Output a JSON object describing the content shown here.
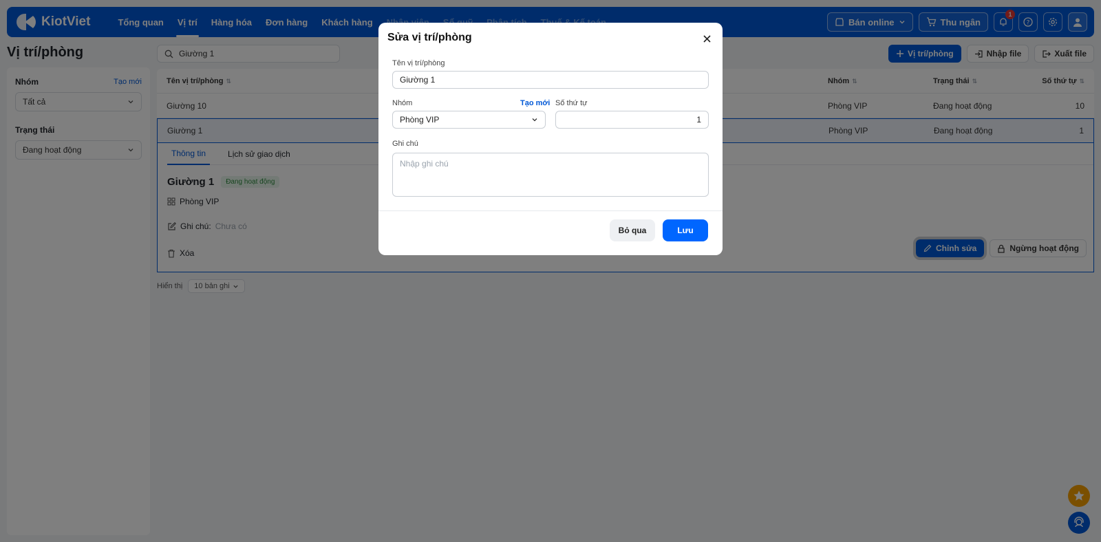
{
  "app": {
    "brand": "KiotViet"
  },
  "nav": {
    "items": [
      "Tổng quan",
      "Vị trí",
      "Hàng hóa",
      "Đơn hàng",
      "Khách hàng",
      "Nhân viên",
      "Sổ quỹ",
      "Phân tích",
      "Thuế & Kế toán"
    ],
    "active": "Vị trí"
  },
  "topbar": {
    "sell_online": "Bán online",
    "cashier": "Thu ngân",
    "notification_count": "1"
  },
  "page": {
    "title": "Vị trí/phòng"
  },
  "sidebar": {
    "group_label": "Nhóm",
    "group_create": "Tạo mới",
    "group_value": "Tất cả",
    "status_label": "Trạng thái",
    "status_value": "Đang hoạt động"
  },
  "toolbar": {
    "search_value": "Giường 1",
    "add_button": "Vị trí/phòng",
    "import_button": "Nhập file",
    "export_button": "Xuất file"
  },
  "table": {
    "headers": {
      "name": "Tên vị trí/phòng",
      "group": "Nhóm",
      "status": "Trạng thái",
      "order": "Số thứ tự"
    },
    "rows": [
      {
        "name": "Giường 10",
        "group": "Phòng VIP",
        "status": "Đang hoạt động",
        "order": "10"
      },
      {
        "name": "Giường 1",
        "group": "Phòng VIP",
        "status": "Đang hoạt động",
        "order": "1"
      }
    ]
  },
  "detail": {
    "tab_info": "Thông tin",
    "tab_history": "Lịch sử giao dịch",
    "name": "Giường 1",
    "status": "Đang hoạt động",
    "group": "Phòng VIP",
    "note_label": "Ghi chú:",
    "note_value": "Chưa có",
    "delete": "Xóa",
    "edit": "Chỉnh sửa",
    "deactivate": "Ngừng hoạt động"
  },
  "pager": {
    "label": "Hiển thị",
    "value": "10 bản ghi"
  },
  "modal": {
    "title": "Sửa vị trí/phòng",
    "name_label": "Tên vị trí/phòng",
    "name_value": "Giường 1",
    "group_label": "Nhóm",
    "group_create": "Tạo mới",
    "group_value": "Phòng VIP",
    "order_label": "Số thứ tự",
    "order_value": "1",
    "note_label": "Ghi chú",
    "note_placeholder": "Nhập ghi chú",
    "cancel": "Bỏ qua",
    "save": "Lưu"
  },
  "colors": {
    "primary": "#0058d6",
    "save": "#0066ff",
    "active_green": "#2e8b3e"
  }
}
